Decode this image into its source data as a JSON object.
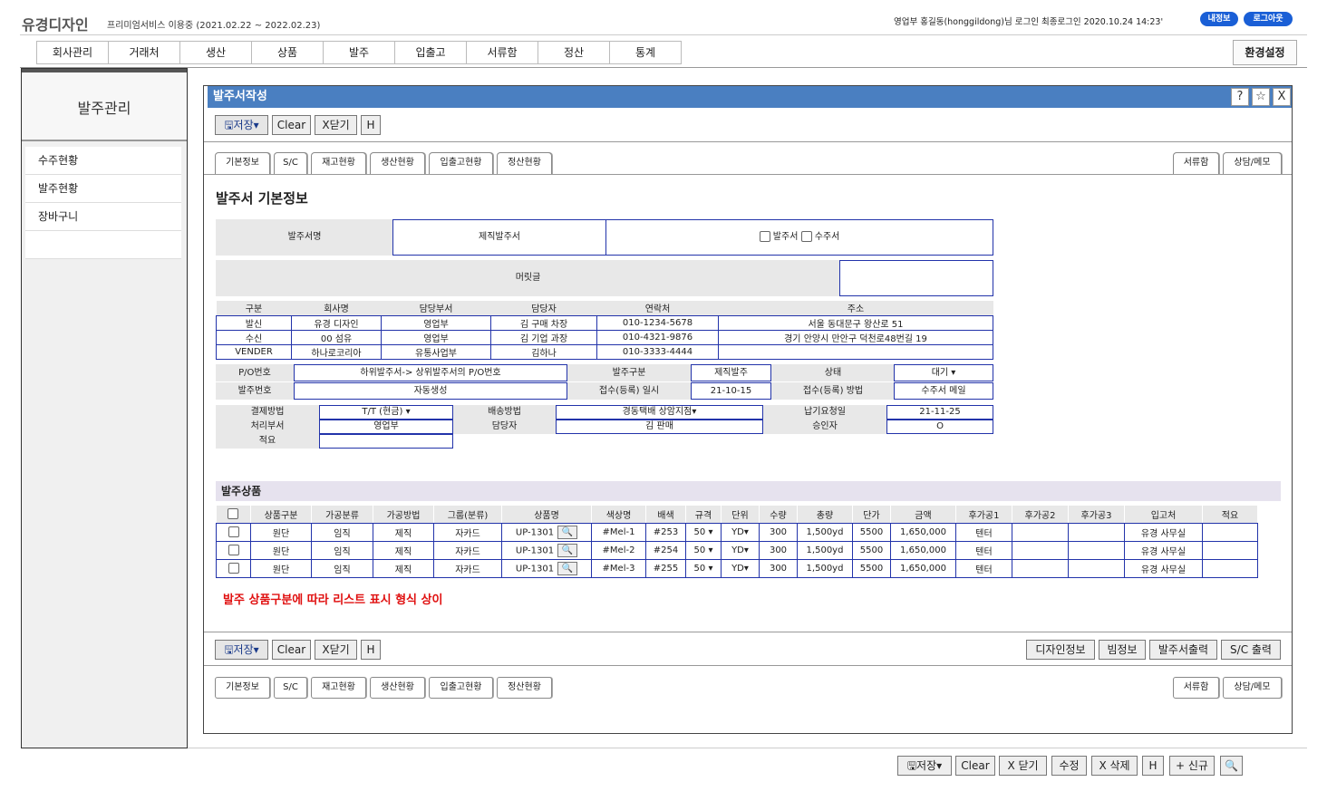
{
  "header": {
    "brand": "유경디자인",
    "service": "프리미엄서비스 이용중 (2021.02.22 ~ 2022.02.23)",
    "userinfo": "영업부 홍길동(honggildong)님 로그인 최종로그인 2020.10.24 14:23'",
    "myinfo": "내정보",
    "logout": "로그아웃"
  },
  "menu": [
    "회사관리",
    "거래처",
    "생산",
    "상품",
    "발주",
    "입출고",
    "서류함",
    "정산",
    "통계"
  ],
  "settings": "환경설정",
  "sidebar": {
    "title": "발주관리",
    "items": [
      "수주현황",
      "발주현황",
      "장바구니"
    ]
  },
  "panel": {
    "title": "발주서작성",
    "icons": [
      "?",
      "☆",
      "X"
    ]
  },
  "toolbar": {
    "save": "저장",
    "clear": "Clear",
    "close": "X닫기",
    "h": "H"
  },
  "tabs": [
    "기본정보",
    "S/C",
    "재고현황",
    "생산현황",
    "입출고현황",
    "정산현황"
  ],
  "righttabs": [
    "서류함",
    "상담/메모"
  ],
  "section_title": "발주서 기본정보",
  "form": {
    "order_name_label": "발주서명",
    "order_name_value": "제직발주서",
    "chk1": "발주서",
    "chk2": "수주서",
    "header_label": "머릿글"
  },
  "parties": {
    "headers": [
      "구분",
      "회사명",
      "담당부서",
      "담당자",
      "연락처",
      "주소"
    ],
    "rows": [
      [
        "발신",
        "유경 디자인",
        "영업부",
        "김 구매 차장",
        "010-1234-5678",
        "서울 동대문구 왕산로 51"
      ],
      [
        "수신",
        "00 섬유",
        "영업부",
        "김 기업 과장",
        "010-4321-9876",
        "경기 안양시 만안구 덕천로48번길 19"
      ],
      [
        "VENDER",
        "하나로코리아",
        "유통사업부",
        "김하나",
        "010-3333-4444",
        ""
      ]
    ]
  },
  "info": {
    "po_label": "P/O번호",
    "po_value": "하위발주서-> 상위발주서의 P/O번호",
    "type_label": "발주구분",
    "type_value": "제직발주",
    "status_label": "상태",
    "status_value": "대기",
    "no_label": "발주번호",
    "no_value": "자동생성",
    "date_label": "접수(등록) 일시",
    "date_value": "21-10-15",
    "method_label": "접수(등록) 방법",
    "method_value": "수주서 메일"
  },
  "pay": {
    "pay_label": "결제방법",
    "pay_value": "T/T (현금)",
    "ship_label": "배송방법",
    "ship_value": "경동택배 상암지점",
    "due_label": "납기요청일",
    "due_value": "21-11-25",
    "dept_label": "처리부서",
    "dept_value": "영업부",
    "mgr_label": "담당자",
    "mgr_value": "김 판매",
    "appr_label": "승인자",
    "appr_value": "O",
    "memo_label": "적요"
  },
  "products": {
    "title": "발주상품",
    "headers": [
      "상품구분",
      "가공분류",
      "가공방법",
      "그룹(분류)",
      "상품명",
      "색상명",
      "배색",
      "규격",
      "단위",
      "수량",
      "총량",
      "단가",
      "금액",
      "후가공1",
      "후가공2",
      "후가공3",
      "입고처",
      "적요"
    ],
    "rows": [
      [
        "원단",
        "임직",
        "제직",
        "자카드",
        "UP-1301",
        "#Mel-1",
        "#253",
        "50",
        "YD",
        "300",
        "1,500yd",
        "5500",
        "1,650,000",
        "텐터",
        "",
        "",
        "유경 사무실",
        ""
      ],
      [
        "원단",
        "임직",
        "제직",
        "자카드",
        "UP-1301",
        "#Mel-2",
        "#254",
        "50",
        "YD",
        "300",
        "1,500yd",
        "5500",
        "1,650,000",
        "텐터",
        "",
        "",
        "유경 사무실",
        ""
      ],
      [
        "원단",
        "임직",
        "제직",
        "자카드",
        "UP-1301",
        "#Mel-3",
        "#255",
        "50",
        "YD",
        "300",
        "1,500yd",
        "5500",
        "1,650,000",
        "텐터",
        "",
        "",
        "유경 사무실",
        ""
      ]
    ]
  },
  "note": "발주 상품구분에 따라 리스트 표시 형식 상이",
  "bottom_buttons": [
    "디자인정보",
    "빔정보",
    "발주서출력",
    "S/C 출력"
  ],
  "footer": {
    "save": "저장",
    "clear": "Clear",
    "close": "X 닫기",
    "edit": "수정",
    "delete": "X 삭제",
    "h": "H",
    "new": "+ 신규"
  }
}
